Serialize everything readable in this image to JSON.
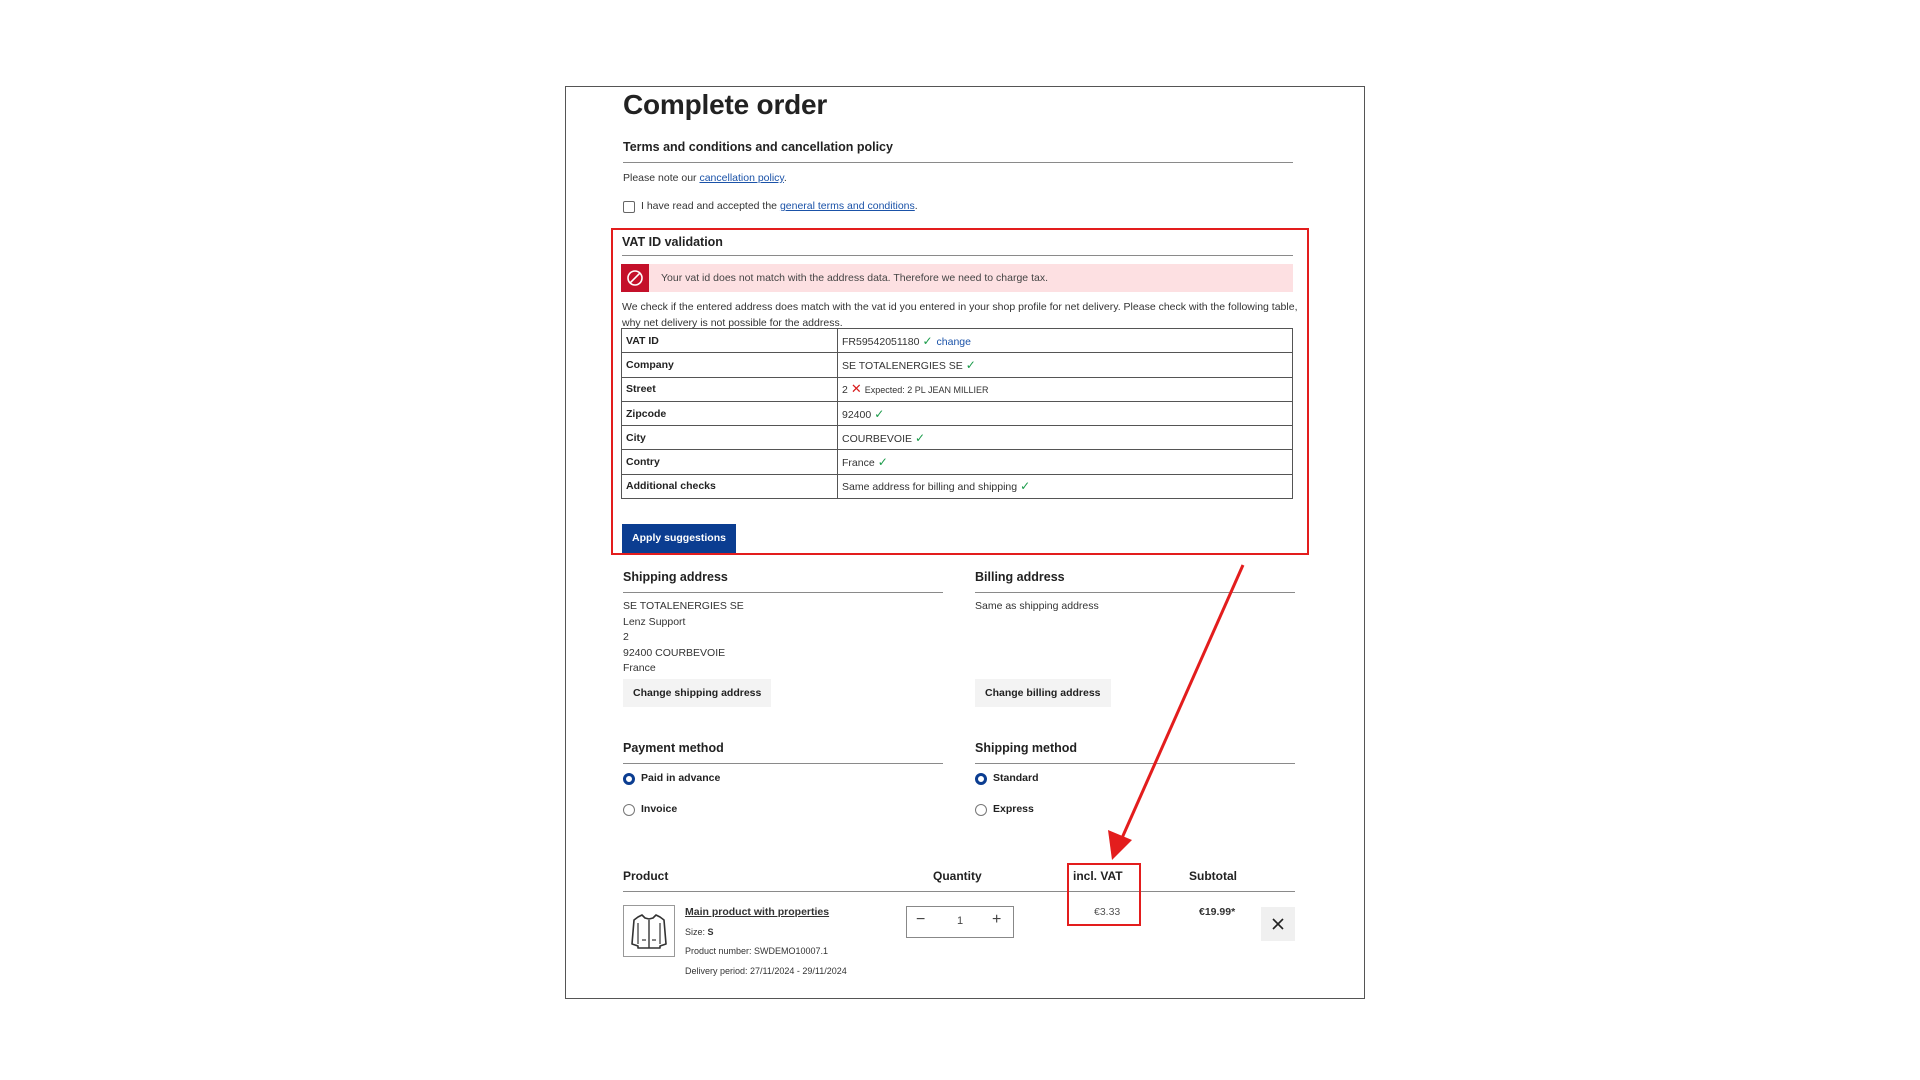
{
  "page": {
    "title": "Complete order"
  },
  "terms": {
    "heading": "Terms and conditions and cancellation policy",
    "note_prefix": "Please note our ",
    "note_link": "cancellation policy",
    "note_suffix": ".",
    "accept_prefix": "I have read and accepted the ",
    "accept_link": "general terms and conditions",
    "accept_suffix": "."
  },
  "vat": {
    "heading": "VAT ID validation",
    "alert": "Your vat id does not match with the address data. Therefore we need to charge tax.",
    "description": "We check if the entered address does match with the vat id you entered in your shop profile for net delivery. Please check with the following table, why net delivery is not possible for the address.",
    "rows": [
      {
        "key": "VAT ID",
        "value": "FR59542051180",
        "status": "ok",
        "extra_link": "change"
      },
      {
        "key": "Company",
        "value": "SE TOTALENERGIES SE",
        "status": "ok"
      },
      {
        "key": "Street",
        "value": "2",
        "status": "bad",
        "expected": "Expected: 2 PL JEAN MILLIER"
      },
      {
        "key": "Zipcode",
        "value": "92400",
        "status": "ok"
      },
      {
        "key": "City",
        "value": "COURBEVOIE",
        "status": "ok"
      },
      {
        "key": "Contry",
        "value": "France",
        "status": "ok"
      },
      {
        "key": "Additional checks",
        "value": "Same address for billing and shipping",
        "status": "ok"
      }
    ],
    "apply_button": "Apply suggestions"
  },
  "shipping_address": {
    "heading": "Shipping address",
    "lines": [
      "SE TOTALENERGIES SE",
      "Lenz Support",
      "2",
      "92400 COURBEVOIE",
      "France"
    ],
    "change_button": "Change shipping address"
  },
  "billing_address": {
    "heading": "Billing address",
    "text": "Same as shipping address",
    "change_button": "Change billing address"
  },
  "payment": {
    "heading": "Payment method",
    "options": [
      {
        "label": "Paid in advance",
        "selected": true
      },
      {
        "label": "Invoice",
        "selected": false
      }
    ]
  },
  "shipping_method": {
    "heading": "Shipping method",
    "options": [
      {
        "label": "Standard",
        "selected": true
      },
      {
        "label": "Express",
        "selected": false
      }
    ]
  },
  "cart": {
    "columns": {
      "product": "Product",
      "quantity": "Quantity",
      "vat": "incl. VAT",
      "subtotal": "Subtotal"
    },
    "item": {
      "name": "Main product with properties",
      "size_label": "Size: ",
      "size_value": "S",
      "number": "Product number: SWDEMO10007.1",
      "delivery": "Delivery period: 27/11/2024 - 29/11/2024",
      "quantity": "1",
      "vat": "€3.33",
      "subtotal": "€19.99*",
      "image_icon": "jacket-icon"
    }
  },
  "colors": {
    "primary": "#0b3d91",
    "highlight": "#e31d1d",
    "alert_bg": "#fde0e2",
    "alert_icon": "#c4102a",
    "ok": "#1a9b4a"
  }
}
